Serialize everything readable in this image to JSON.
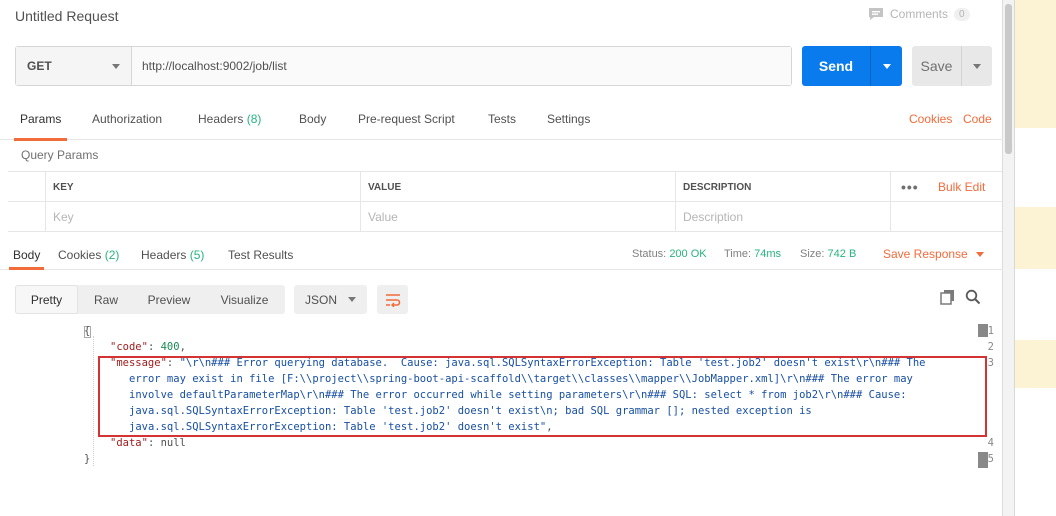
{
  "request": {
    "title": "Untitled Request",
    "comments_label": "Comments",
    "comments_count": "0",
    "method": "GET",
    "url": "http://localhost:9002/job/list",
    "send_label": "Send",
    "save_label": "Save"
  },
  "request_tabs": {
    "params": "Params",
    "authorization": "Authorization",
    "headers": "Headers",
    "headers_count": "(8)",
    "body": "Body",
    "prerequest": "Pre-request Script",
    "tests": "Tests",
    "settings": "Settings",
    "cookies": "Cookies",
    "code": "Code"
  },
  "query_params": {
    "title": "Query Params",
    "col_key": "KEY",
    "col_value": "VALUE",
    "col_description": "DESCRIPTION",
    "more": "•••",
    "bulk_edit": "Bulk Edit",
    "key_placeholder": "Key",
    "value_placeholder": "Value",
    "description_placeholder": "Description"
  },
  "response_tabs": {
    "body": "Body",
    "cookies": "Cookies",
    "cookies_count": "(2)",
    "headers": "Headers",
    "headers_count": "(5)",
    "test_results": "Test Results",
    "status_label": "Status:",
    "status_value": "200 OK",
    "time_label": "Time:",
    "time_value": "74ms",
    "size_label": "Size:",
    "size_value": "742 B",
    "save_response": "Save Response"
  },
  "view": {
    "pretty": "Pretty",
    "raw": "Raw",
    "preview": "Preview",
    "visualize": "Visualize",
    "format": "JSON"
  },
  "editor": {
    "line_numbers": [
      "1",
      "2",
      "3",
      "4",
      "5"
    ],
    "open_brace": "{",
    "code_key": "\"code\"",
    "code_value": "400",
    "message_key": "\"message\"",
    "message_lines": [
      "\"\\r\\n### Error querying database.  Cause: java.sql.SQLSyntaxErrorException: Table 'test.job2' doesn't exist\\r\\n### The",
      "error may exist in file [F:\\\\project\\\\spring-boot-api-scaffold\\\\target\\\\classes\\\\mapper\\\\JobMapper.xml]\\r\\n### The error may",
      "involve defaultParameterMap\\r\\n### The error occurred while setting parameters\\r\\n### SQL: select * from job2\\r\\n### Cause:",
      "java.sql.SQLSyntaxErrorException: Table 'test.job2' doesn't exist\\n; bad SQL grammar []; nested exception is",
      "java.sql.SQLSyntaxErrorException: Table 'test.job2' doesn't exist\""
    ],
    "data_key": "\"data\"",
    "data_value": "null",
    "close_brace": "}"
  }
}
